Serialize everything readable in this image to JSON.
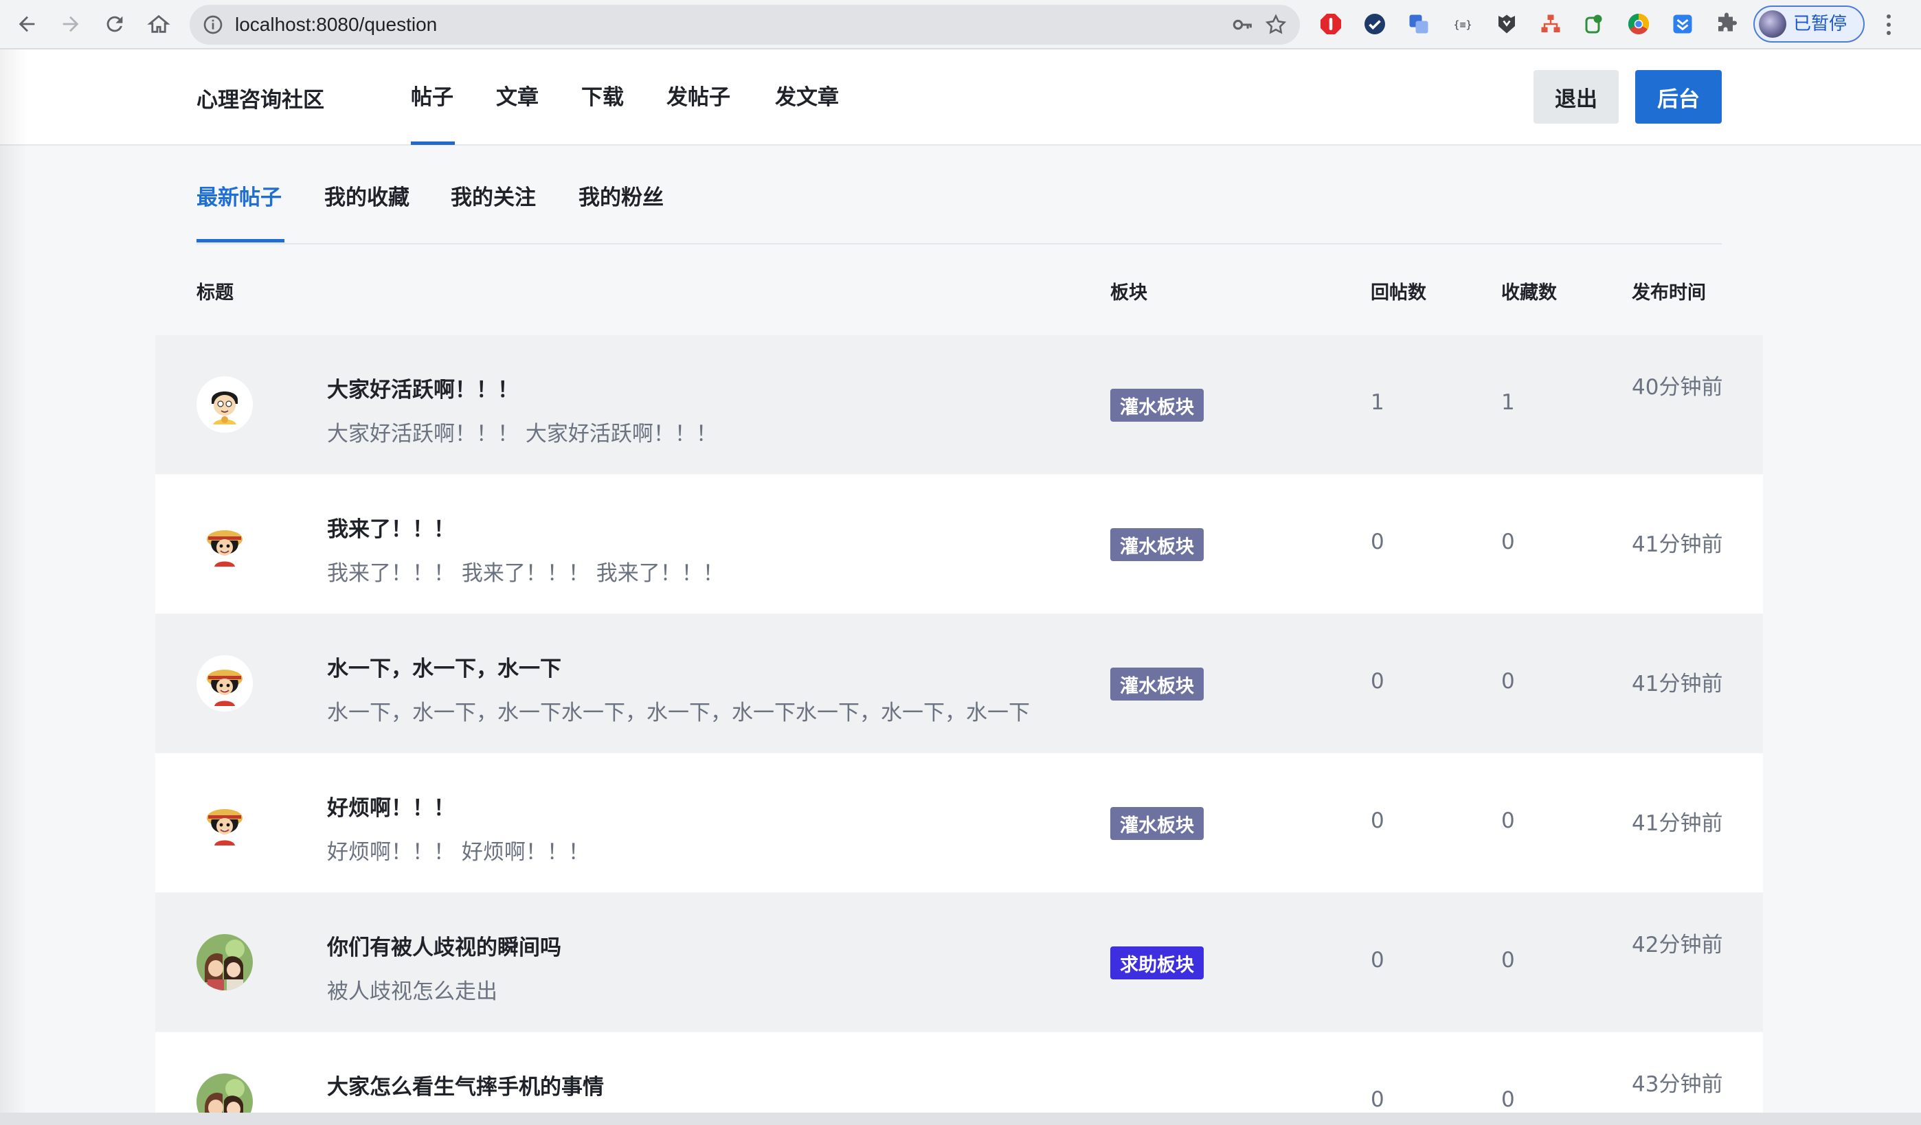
{
  "browser": {
    "url": "localhost:8080/question",
    "profile_label": "已暂停"
  },
  "header": {
    "logo": "心理咨询社区",
    "nav": [
      "帖子",
      "文章",
      "下载",
      "发帖子",
      "发文章"
    ],
    "logout_label": "退出",
    "admin_label": "后台"
  },
  "subtabs": [
    "最新帖子",
    "我的收藏",
    "我的关注",
    "我的粉丝"
  ],
  "table": {
    "headers": [
      "标题",
      "板块",
      "回帖数",
      "收藏数",
      "发布时间"
    ],
    "rows": [
      {
        "avatar": "doraemon-nobita-avatar",
        "title": "大家好活跃啊！！！",
        "excerpt": "大家好活跃啊！！！ 大家好活跃啊！！！",
        "board": "灌水板块",
        "board_color": "#6e72a0",
        "replies": "1",
        "favorites": "1",
        "time": "40分钟前"
      },
      {
        "avatar": "luffy-avatar",
        "title": "我来了！！！",
        "excerpt": "我来了！！！ 我来了！！！ 我来了！！！",
        "board": "灌水板块",
        "board_color": "#6e72a0",
        "replies": "0",
        "favorites": "0",
        "time": "41分钟前"
      },
      {
        "avatar": "luffy-avatar",
        "title": "水一下，水一下，水一下",
        "excerpt": "水一下，水一下，水一下水一下，水一下，水一下水一下，水一下，水一下",
        "board": "灌水板块",
        "board_color": "#6e72a0",
        "replies": "0",
        "favorites": "0",
        "time": "41分钟前"
      },
      {
        "avatar": "luffy-avatar",
        "title": "好烦啊！！！",
        "excerpt": "好烦啊！！！ 好烦啊！！！",
        "board": "灌水板块",
        "board_color": "#6e72a0",
        "replies": "0",
        "favorites": "0",
        "time": "41分钟前"
      },
      {
        "avatar": "anime-couple-avatar",
        "title": "你们有被人歧视的瞬间吗",
        "excerpt": "被人歧视怎么走出",
        "board": "求助板块",
        "board_color": "#3d2fe0",
        "replies": "0",
        "favorites": "0",
        "time": "42分钟前"
      },
      {
        "avatar": "anime-couple-avatar",
        "title": "大家怎么看生气摔手机的事情",
        "excerpt": "",
        "board": "",
        "board_color": "#3fb8f0",
        "replies": "0",
        "favorites": "0",
        "time": "43分钟前"
      }
    ]
  },
  "colors": {
    "accent": "#1f6ed4",
    "header_border": "#e5e7eb"
  }
}
